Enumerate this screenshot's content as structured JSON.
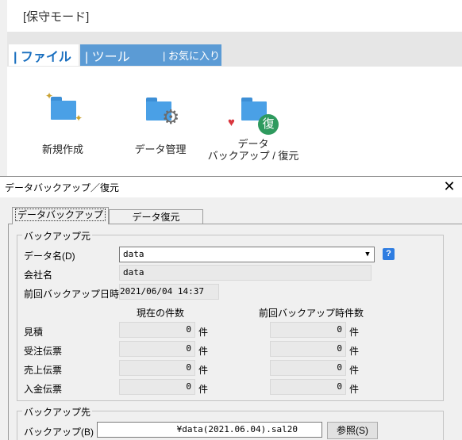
{
  "app": {
    "title": "[保守モード]",
    "tabs": [
      {
        "label": "| ファイル",
        "active": true
      },
      {
        "label": "| ツール",
        "active": false
      },
      {
        "label": "| お気に入り",
        "active": false
      }
    ],
    "ribbon": [
      {
        "label": "新規作成",
        "icon": "new-folder-icon"
      },
      {
        "label": "データ管理",
        "icon": "folder-gear-icon"
      },
      {
        "label": "データ",
        "label2": "バックアップ / 復元",
        "icon": "folder-heart-restore-icon"
      }
    ],
    "restore_badge": "復"
  },
  "dialog": {
    "title": "データバックアップ／復元",
    "close": "✕",
    "tabs": {
      "backup": "データバックアップ",
      "restore": "データ復元"
    },
    "source": {
      "group_label": "バックアップ元",
      "data_name_label": "データ名(D)",
      "data_name_value": "data",
      "help": "?",
      "company_label": "会社名",
      "company_value": "data",
      "last_backup_label": "前回バックアップ日時",
      "last_backup_value": "2021/06/04 14:37",
      "col_current": "現在の件数",
      "col_last": "前回バックアップ時件数",
      "unit": "件",
      "rows": [
        {
          "label": "見積",
          "current": "0",
          "last": "0"
        },
        {
          "label": "受注伝票",
          "current": "0",
          "last": "0"
        },
        {
          "label": "売上伝票",
          "current": "0",
          "last": "0"
        },
        {
          "label": "入金伝票",
          "current": "0",
          "last": "0"
        }
      ]
    },
    "destination": {
      "group_label": "バックアップ先",
      "backup_label": "バックアップ(B)",
      "backup_value": "¥data(2021.06.04).sal20",
      "browse": "参照(S)"
    }
  },
  "colors": {
    "accent": "#1a6fbf",
    "tab_inactive": "#5b9bd5",
    "folder": "#4aa0e6",
    "heart": "#d9363e",
    "badge": "#2e9a5e",
    "help": "#2f7de1"
  }
}
